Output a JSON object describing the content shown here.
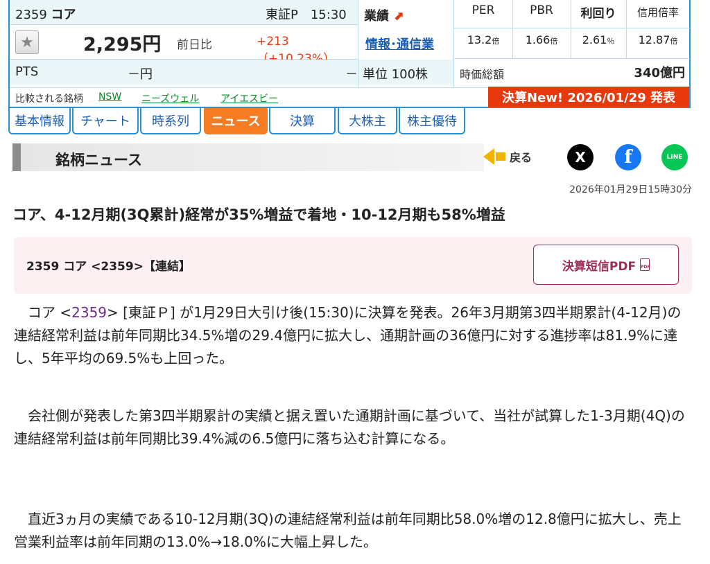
{
  "quote": {
    "code": "2359",
    "name": "コア",
    "market_time": "東証P　15:30",
    "price": "2,295円",
    "prev_label": "前日比",
    "change": "+213 （+10.23%）",
    "pts_label": "PTS",
    "pts_value": "－円",
    "pts_dash": "－",
    "gyoseki_label": "業績",
    "sector": "情報･通信業",
    "unit": "単位 100株",
    "metrics": [
      {
        "head": "PER",
        "value": "13.2",
        "unit": "倍"
      },
      {
        "head": "PBR",
        "value": "1.66",
        "unit": "倍"
      },
      {
        "head": "利回り",
        "value": "2.61",
        "unit": "％"
      },
      {
        "head": "信用倍率",
        "value": "12.87",
        "unit": "倍"
      }
    ],
    "market_cap_label": "時価総額",
    "market_cap": "340億円",
    "compare_label": "比較される銘柄",
    "compare_links": [
      "NSW",
      "ニーズウェル",
      "アイエスビー"
    ],
    "kessan_banner": "決算New! 2026/01/29 発表"
  },
  "tabs": [
    "基本情報",
    "チャート",
    "時系列",
    "ニュース",
    "決算",
    "大株主",
    "株主優待"
  ],
  "active_tab": "ニュース",
  "news_bar_title": "銘柄ニュース",
  "back_label": "戻る",
  "social": {
    "x": "X",
    "facebook": "f",
    "line": "LINE"
  },
  "date": "2026年01月29日15時30分",
  "headline": "コア、4-12月期(3Q累計)経常が35%増益で着地・10-12月期も58%増益",
  "info_title": "2359  コア <2359>【連結】",
  "pdf_button": "決算短信PDF",
  "pdf_icon": "PDF",
  "paragraphs": {
    "p1_pre": "コア <",
    "p1_code": "2359",
    "p1_post": "> [東証Ｐ] が1月29日大引け後(15:30)に決算を発表。26年3月期第3四半期累計(4-12月)の連結経常利益は前年同期比34.5%増の29.4億円に拡大し、通期計画の36億円に対する進捗率は81.9%に達し、5年平均の69.5%も上回った。",
    "p2": "会社側が発表した第3四半期累計の実績と据え置いた通期計画に基づいて、当社が試算した1-3月期(4Q)の連結経常利益は前年同期比39.4%減の6.5億円に落ち込む計算になる。",
    "p3": "直近3ヵ月の実績である10-12月期(3Q)の連結経常利益は前年同期比58.0%増の12.8億円に拡大し、売上営業利益率は前年同期の13.0%→18.0%に大幅上昇した。"
  }
}
